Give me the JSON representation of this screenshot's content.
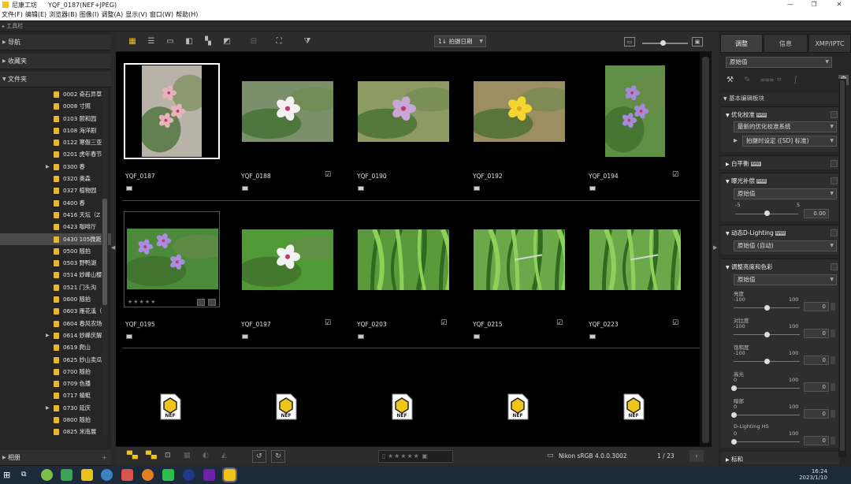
{
  "window": {
    "app_name": "尼康工坊",
    "title": "YQF_0187(NEF+JPEG)",
    "minimize": "—",
    "maximize": "❐",
    "close": "✕"
  },
  "menu": [
    "文件(F)",
    "编辑(E)",
    "浏览器(B)",
    "图像(I)",
    "调整(A)",
    "显示(V)",
    "窗口(W)",
    "帮助(H)"
  ],
  "toolbar_label": "工具栏",
  "left_panel": {
    "nav": "导航",
    "favorites": "收藏夹",
    "folders": "文件夹",
    "albums": "相册",
    "add": "+",
    "items": [
      {
        "label": "0002 奇石异草",
        "expandable": false,
        "selected": false
      },
      {
        "label": "0008 寸照",
        "expandable": false,
        "selected": false
      },
      {
        "label": "0103 颐和园",
        "expandable": false,
        "selected": false
      },
      {
        "label": "0108 海洋剧",
        "expandable": false,
        "selected": false
      },
      {
        "label": "0122 寒假三亚",
        "expandable": false,
        "selected": false
      },
      {
        "label": "0201 虎年春节",
        "expandable": false,
        "selected": false
      },
      {
        "label": "0300 春",
        "expandable": true,
        "selected": false
      },
      {
        "label": "0320 奥森",
        "expandable": false,
        "selected": false
      },
      {
        "label": "0327 植物园",
        "expandable": false,
        "selected": false
      },
      {
        "label": "0400 春",
        "expandable": false,
        "selected": false
      },
      {
        "label": "0416 天坛（Z",
        "expandable": false,
        "selected": false
      },
      {
        "label": "0423 咖啡厅",
        "expandable": false,
        "selected": false
      },
      {
        "label": "0430 105微距",
        "expandable": false,
        "selected": true
      },
      {
        "label": "0500 随拍",
        "expandable": false,
        "selected": false
      },
      {
        "label": "0503 野鸭湖",
        "expandable": false,
        "selected": false
      },
      {
        "label": "0514 妙峰山樱",
        "expandable": false,
        "selected": false
      },
      {
        "label": "0521 门头沟",
        "expandable": false,
        "selected": false
      },
      {
        "label": "0600 随拍",
        "expandable": false,
        "selected": false
      },
      {
        "label": "0603 雁花溪（",
        "expandable": false,
        "selected": false
      },
      {
        "label": "0604 春风农场",
        "expandable": false,
        "selected": false
      },
      {
        "label": "0614 妙峰庆解",
        "expandable": true,
        "selected": false
      },
      {
        "label": "0619 爬山",
        "expandable": false,
        "selected": false
      },
      {
        "label": "0625 妙山卖瓜",
        "expandable": false,
        "selected": false
      },
      {
        "label": "0700 随拍",
        "expandable": false,
        "selected": false
      },
      {
        "label": "0709 色播",
        "expandable": false,
        "selected": false
      },
      {
        "label": "0717 蜻蜓",
        "expandable": false,
        "selected": false
      },
      {
        "label": "0730 延庆",
        "expandable": true,
        "selected": false
      },
      {
        "label": "0800 随拍",
        "expandable": false,
        "selected": false
      },
      {
        "label": "0825 米南展",
        "expandable": false,
        "selected": false
      }
    ]
  },
  "view_toolbar": {
    "sort_label": "拍摄日期",
    "sort_prefix": "1↓"
  },
  "thumbnails": [
    {
      "name": "YQF_0187",
      "kind": "flower-pink-tall",
      "edited": false,
      "selected": true
    },
    {
      "name": "YQF_0188",
      "kind": "flower-white",
      "edited": true,
      "selected": false
    },
    {
      "name": "YQF_0190",
      "kind": "flower-purple",
      "edited": false,
      "selected": false
    },
    {
      "name": "YQF_0192",
      "kind": "flower-yellow",
      "edited": false,
      "selected": false
    },
    {
      "name": "YQF_0194",
      "kind": "flower-violet-tall",
      "edited": true,
      "selected": false
    },
    {
      "name": "YQF_0195",
      "kind": "flower-violet-wide",
      "edited": false,
      "selected": false,
      "rating_row": true
    },
    {
      "name": "YQF_0197",
      "kind": "flower-white-leaf",
      "edited": true,
      "selected": false
    },
    {
      "name": "YQF_0203",
      "kind": "grass",
      "edited": true,
      "selected": false
    },
    {
      "name": "YQF_0215",
      "kind": "grass-dragonfly",
      "edited": true,
      "selected": false
    },
    {
      "name": "YQF_0223",
      "kind": "grass-dragonfly",
      "edited": true,
      "selected": false
    }
  ],
  "nef_label": "NEF",
  "rating_stars": "★★★★★",
  "bottom_bar": {
    "profile": "Nikon sRGB 4.0.0.3002",
    "page": "1 / 23"
  },
  "right_panel": {
    "tabs": [
      "调整",
      "信息",
      "XMP/IPTC"
    ],
    "preset": "原始值",
    "basic_section": "基本编辑板块",
    "picture_control": {
      "title": "优化校准",
      "raw": "RAW",
      "value": "最新的优化校准系统",
      "sub": "拍摄时设定 ([SD] 标准)"
    },
    "white_balance": {
      "title": "白平衡",
      "raw": "RAW"
    },
    "exposure": {
      "title": "曝光补偿",
      "raw": "RAW",
      "value": "原始值",
      "min": "-5",
      "max": "5",
      "num": "0.00",
      "level": 0.5
    },
    "adl": {
      "title": "动态D-Lighting",
      "raw": "RAW",
      "value": "原始值 (自动)"
    },
    "tone": {
      "title": "调整亮度和色彩",
      "value": "原始值",
      "sliders": [
        {
          "label": "亮度",
          "min": "-100",
          "max": "100",
          "num": "0",
          "level": 0.5
        },
        {
          "label": "对比度",
          "min": "-100",
          "max": "100",
          "num": "0",
          "level": 0.5
        },
        {
          "label": "饱和度",
          "min": "-100",
          "max": "100",
          "num": "0",
          "level": 0.5
        },
        {
          "label": "高光",
          "min": "0",
          "max": "100",
          "num": "0",
          "level": 0
        },
        {
          "label": "暗部",
          "min": "0",
          "max": "100",
          "num": "0",
          "level": 0
        },
        {
          "label": "D-Lighting HS",
          "min": "0",
          "max": "100",
          "num": "0",
          "level": 0
        }
      ]
    },
    "bottom_label": "标和"
  },
  "taskbar": {
    "time": "16:24",
    "date": "2023/1/10"
  }
}
